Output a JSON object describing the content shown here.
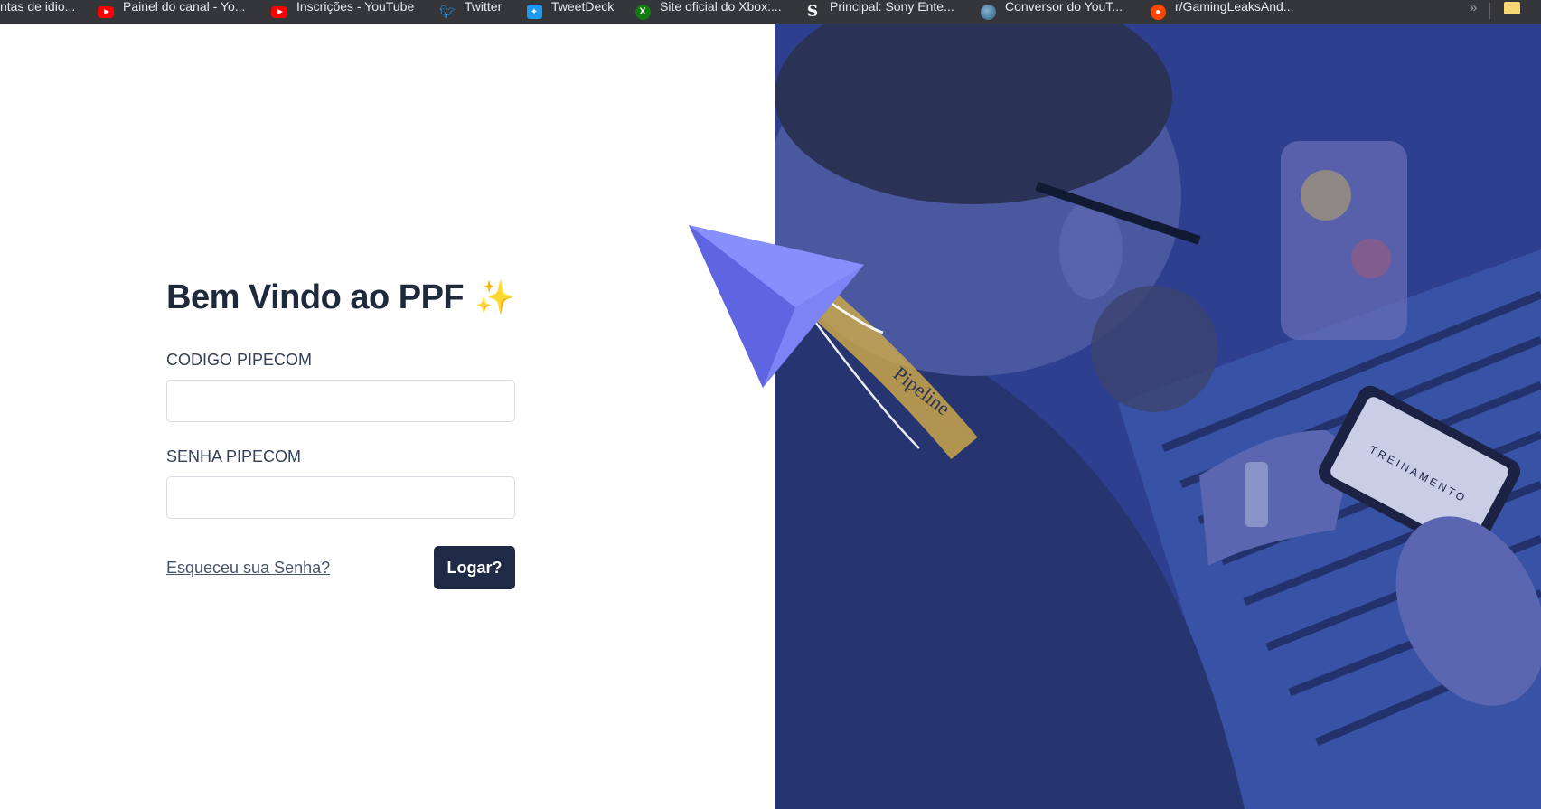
{
  "bookmarks": [
    {
      "label": "ntas de idio...",
      "icon": "none"
    },
    {
      "label": "Painel do canal - Yo...",
      "icon": "youtube-icon"
    },
    {
      "label": "Inscrições - YouTube",
      "icon": "youtube-icon"
    },
    {
      "label": "Twitter",
      "icon": "twitter-icon"
    },
    {
      "label": "TweetDeck",
      "icon": "tweetdeck-icon"
    },
    {
      "label": "Site oficial do Xbox:...",
      "icon": "xbox-icon"
    },
    {
      "label": "Principal: Sony Ente...",
      "icon": "sony-icon"
    },
    {
      "label": "Conversor do YouT...",
      "icon": "converter-icon"
    },
    {
      "label": "r/GamingLeaksAnd...",
      "icon": "reddit-icon"
    }
  ],
  "bookmarks_more": "»",
  "login": {
    "title": "Bem Vindo ao PPF",
    "title_emoji": "✨",
    "code_label": "CODIGO PIPECOM",
    "code_value": "",
    "password_label": "SENHA PIPECOM",
    "password_value": "",
    "forgot_link": "Esqueceu sua Senha?",
    "submit_label": "Logar?"
  },
  "hero": {
    "lanyard_text": "Pipeline",
    "tablet_text": "TREINAMENTO"
  },
  "colors": {
    "primary_button": "#1e2a46",
    "title": "#1e293b",
    "hero_overlay": "#2d3d8a",
    "plane": "#6b73f0"
  }
}
